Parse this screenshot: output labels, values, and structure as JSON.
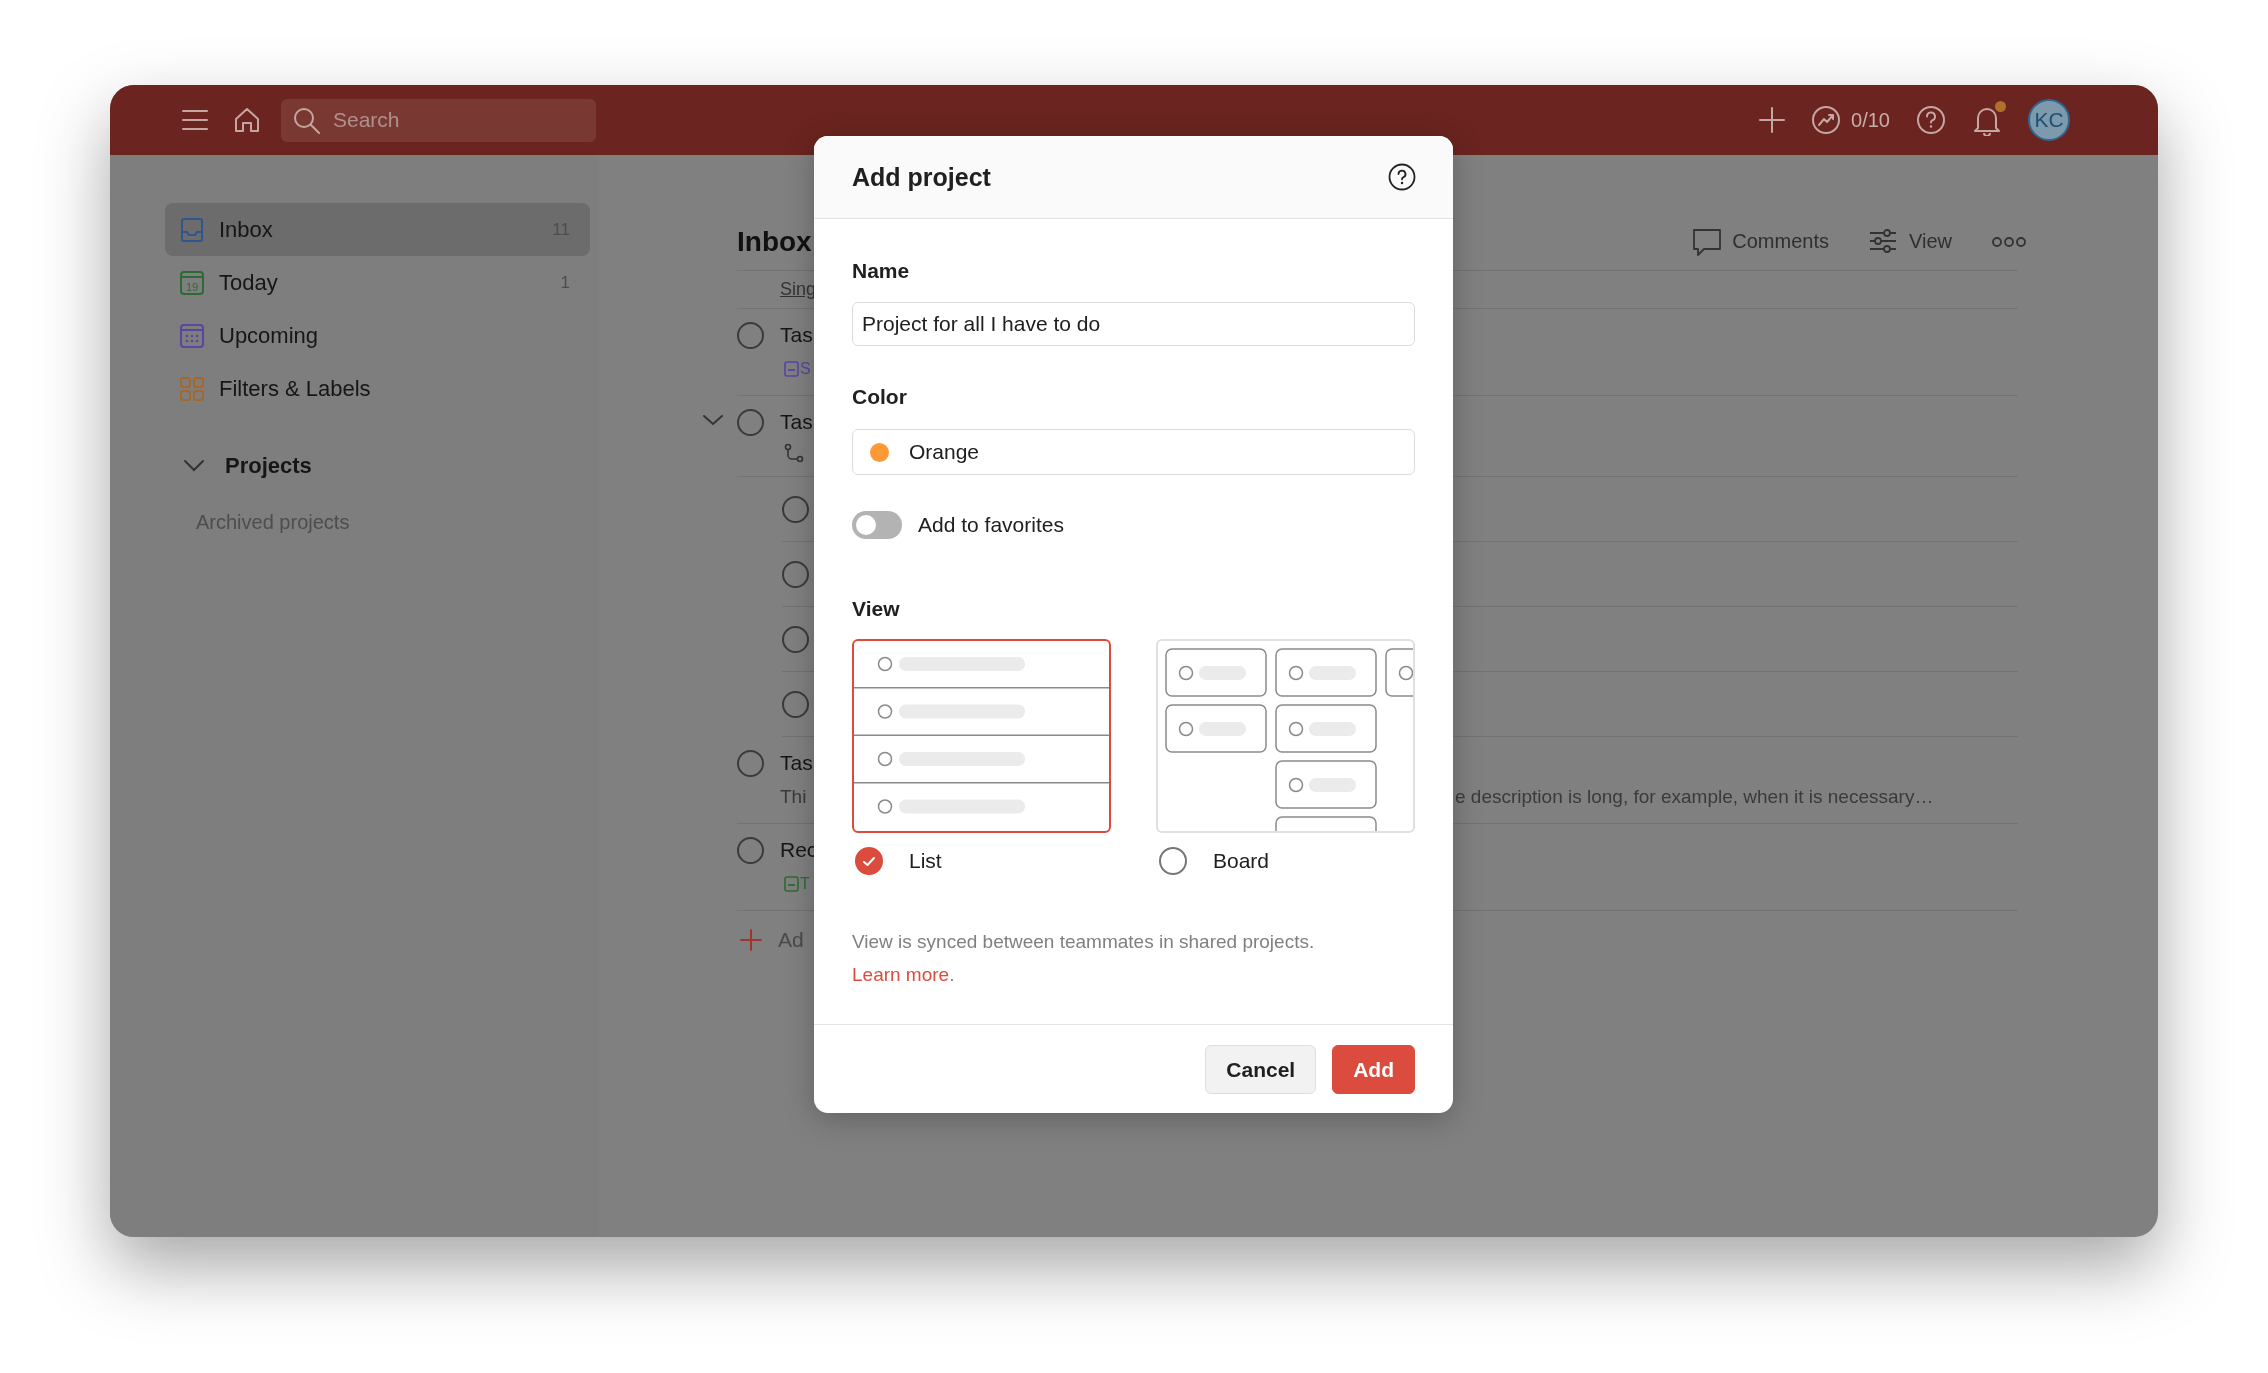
{
  "topbar": {
    "search": {
      "placeholder": "Search"
    },
    "karma": "0/10",
    "avatar": "KC",
    "notifications_unread": true
  },
  "sidebar": {
    "items": [
      {
        "label": "Inbox",
        "count": "11",
        "selected": true
      },
      {
        "label": "Today",
        "count": "1",
        "date_badge": "19",
        "selected": false
      },
      {
        "label": "Upcoming",
        "selected": false
      },
      {
        "label": "Filters & Labels",
        "selected": false
      }
    ],
    "projects": {
      "label": "Projects",
      "expanded": true
    },
    "archived": "Archived projects"
  },
  "main": {
    "title": "Inbox",
    "subtitle": "Sing",
    "actions": [
      {
        "label": "Comments"
      },
      {
        "label": "View"
      }
    ],
    "tasks": [
      {
        "title": "Tas",
        "checked": false,
        "meta": "S",
        "color": "#5a45a0"
      },
      {
        "title": "Tas",
        "checked": false,
        "expanded": true,
        "children": [
          {
            "checked": false
          },
          {
            "checked": false
          },
          {
            "checked": false
          },
          {
            "checked": false
          }
        ]
      },
      {
        "title": "Tas",
        "checked": false,
        "description_start": "Thi",
        "description_end": "e description is long, for example, when it is necessary…"
      },
      {
        "title": "Rec",
        "checked": false,
        "meta": "T",
        "color": "#2d6b34"
      }
    ],
    "add_task": "Ad"
  },
  "dialog": {
    "title": "Add project",
    "name": {
      "label": "Name",
      "value": "Project for all I have to do"
    },
    "color": {
      "label": "Color",
      "value": "Orange",
      "color": "#ff9933"
    },
    "favorites": {
      "label": "Add to favorites",
      "on": false
    },
    "view": {
      "label": "View",
      "options": [
        {
          "kind": "list",
          "label": "List",
          "selected": true
        },
        {
          "kind": "board",
          "label": "Board",
          "selected": false
        }
      ]
    },
    "note": {
      "text": "View is synced between teammates in shared projects. ",
      "link": "Learn more",
      "after": "."
    },
    "buttons": [
      {
        "kind": "secondary",
        "label": "Cancel"
      },
      {
        "kind": "primary",
        "label": "Add"
      }
    ]
  }
}
